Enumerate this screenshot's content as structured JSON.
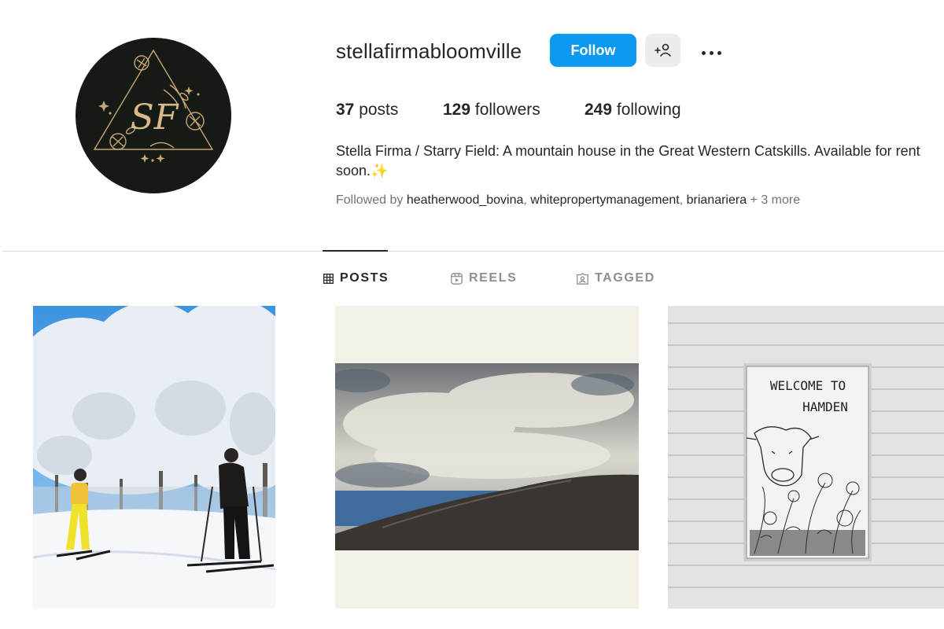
{
  "profile": {
    "username": "stellafirmabloomville",
    "avatar_monogram": "SF",
    "follow_label": "Follow",
    "suggest_icon": "add-person-icon",
    "more_icon": "ellipsis-icon",
    "stats": {
      "posts_count": "37",
      "posts_label": " posts",
      "followers_count": "129",
      "followers_label": " followers",
      "following_count": "249",
      "following_label": " following"
    },
    "bio_line1": "Stella Firma / Starry Field: A mountain house in the Great Western Catskills. Available for rent",
    "bio_line2": "soon.",
    "bio_emoji": "✨",
    "followed_by": {
      "prefix": "Followed by ",
      "accounts": [
        "heatherwood_bovina",
        "whitepropertymanagement",
        "brianariera"
      ],
      "more": " + 3 more"
    }
  },
  "tabs": [
    {
      "label": "POSTS",
      "icon": "grid-icon",
      "active": true
    },
    {
      "label": "REELS",
      "icon": "reels-icon",
      "active": false
    },
    {
      "label": "TAGGED",
      "icon": "tagged-icon",
      "active": false
    }
  ],
  "posts": [
    {
      "description": "ski-photo"
    },
    {
      "description": "sky-hill-photo"
    },
    {
      "description": "welcome-sign-photo",
      "sign_line1": "WELCOME TO",
      "sign_line2": "HAMDEN"
    }
  ],
  "colors": {
    "follow_button": "#0d99f2",
    "avatar_background": "#151a14",
    "avatar_gold": "#c9a574",
    "secondary_text": "#737373",
    "sparkle": "#f3c33d"
  }
}
